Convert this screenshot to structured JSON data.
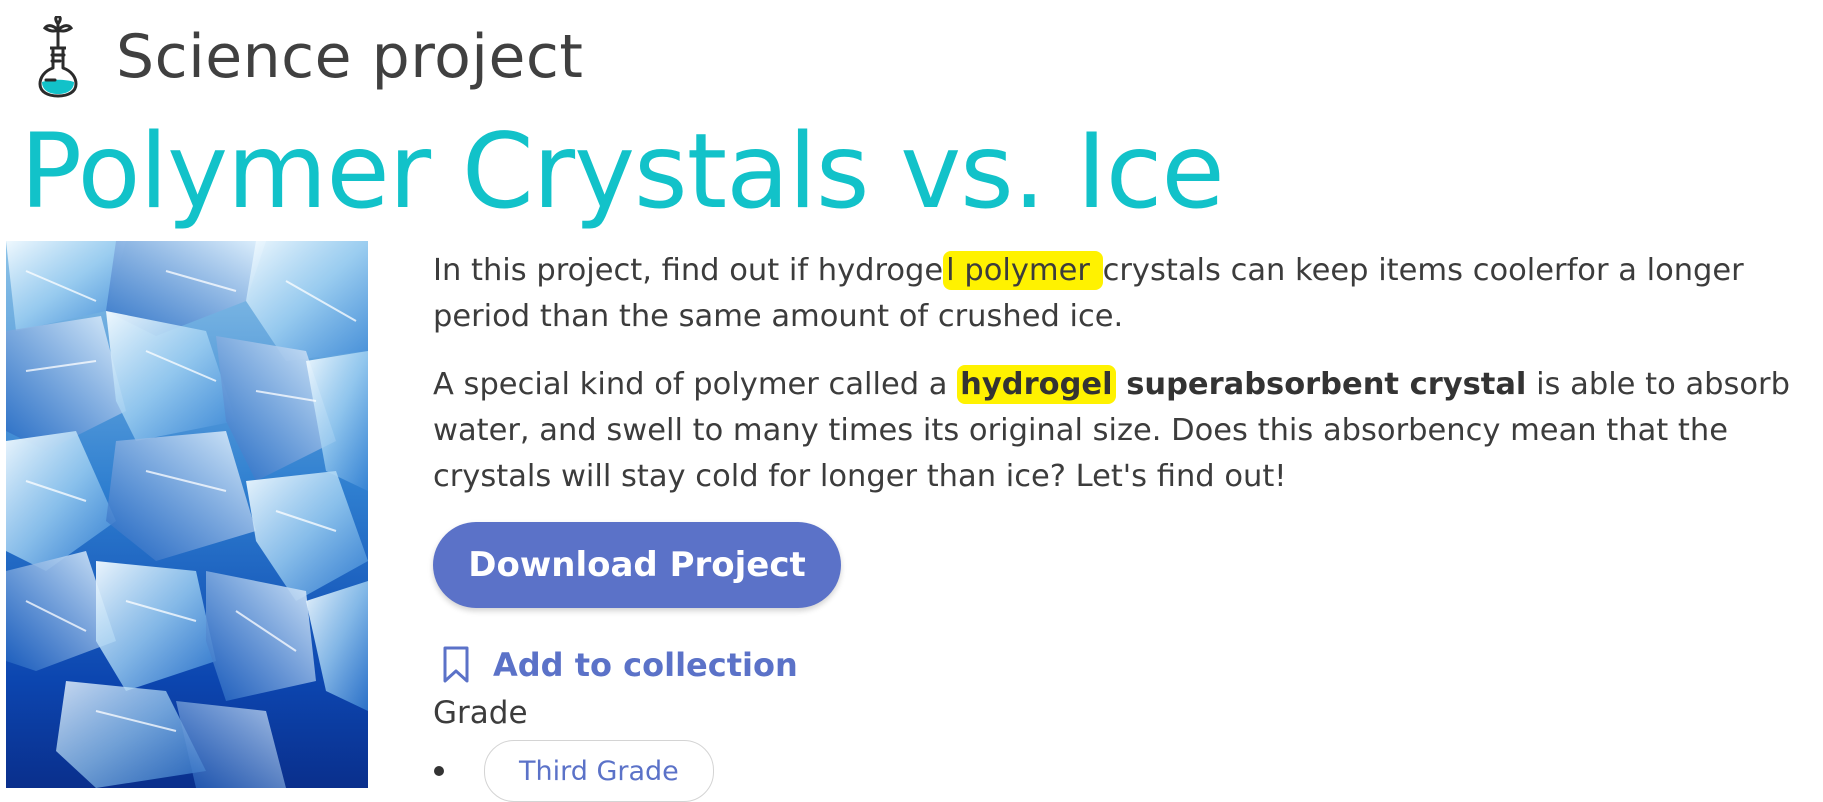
{
  "header": {
    "type_label": "Science project",
    "type_icon": "flask-plant-icon",
    "title": "Polymer Crystals vs. Ice"
  },
  "image": {
    "alt": "Ice cubes and crystals on blue",
    "icon": "ice-crystals-image"
  },
  "description": {
    "p1_before": "In this project, find out if hydroge",
    "p1_highlight": "l polymer ",
    "p1_after": "crystals can keep items coolerfor a longer period than the same amount of crushed ice.",
    "p2_before": "A special kind of polymer called a ",
    "p2_highlight_bold": "hydrogel",
    "p2_bold_rest": " superabsorbent crystal",
    "p2_after": " is able to absorb water, and swell to many times its original size. Does this absorbency mean that the crystals will stay cold for longer than ice? Let's find out!"
  },
  "actions": {
    "download_label": "Download Project",
    "collection_label": "Add to collection",
    "collection_icon": "bookmark-icon"
  },
  "grade": {
    "label": "Grade",
    "items": [
      "Third Grade"
    ]
  },
  "colors": {
    "title": "#12c2c9",
    "button": "#5b72c8",
    "highlight": "#fff200"
  }
}
